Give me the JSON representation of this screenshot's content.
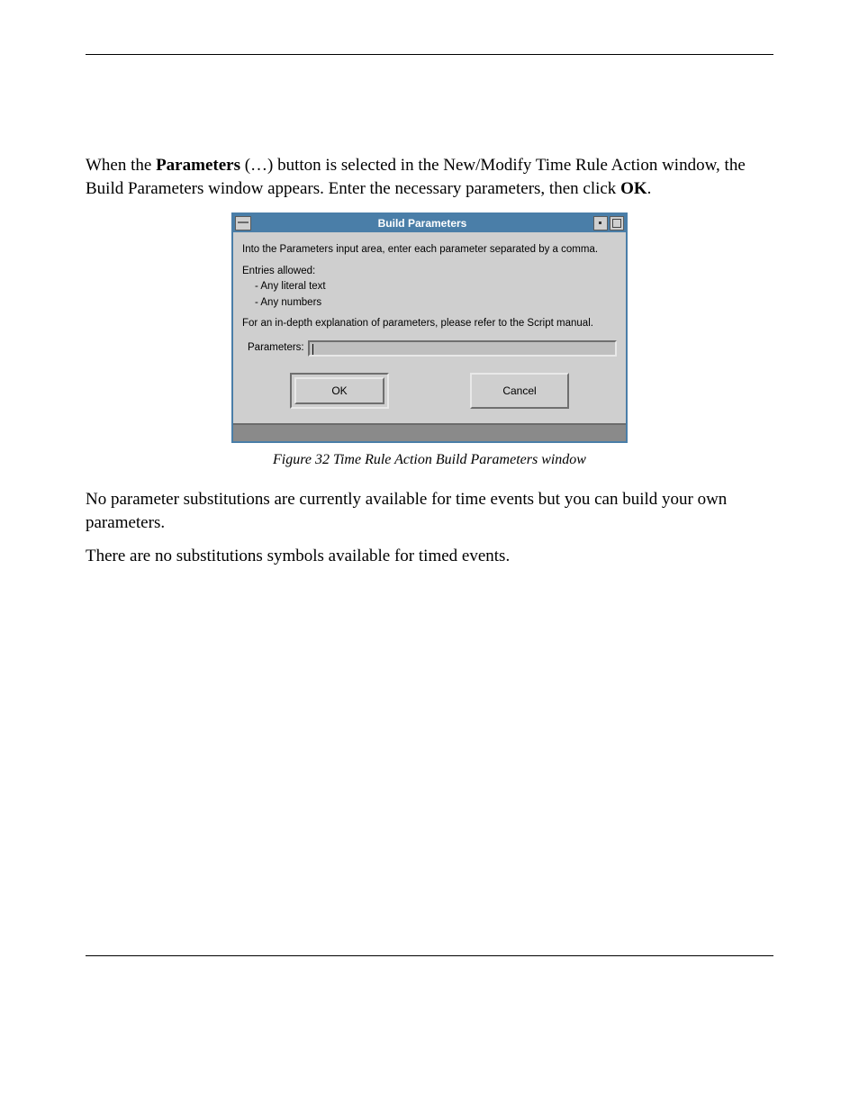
{
  "paragraphs": {
    "intro_pre": "When the ",
    "intro_bold1": "Parameters",
    "intro_mid": " (…) button is selected in the New/Modify Time Rule Action window, the Build Parameters window appears. Enter the necessary parameters, then click ",
    "intro_bold2": "OK",
    "intro_post": ".",
    "afterfig1": "No parameter substitutions are currently available for time events but you can build your own parameters.",
    "afterfig2": "There are no substitutions symbols available for timed events."
  },
  "dialog": {
    "title": "Build Parameters",
    "instr1": "Into the Parameters input area, enter each parameter separated by a comma.",
    "entries_label": "Entries allowed:",
    "entry1": "- Any literal text",
    "entry2": "- Any numbers",
    "instr2": "For an in-depth explanation of parameters, please refer to the Script manual.",
    "param_label": "Parameters:",
    "param_value": "",
    "ok_label": "OK",
    "cancel_label": "Cancel"
  },
  "caption": "Figure 32 Time Rule Action Build Parameters window"
}
